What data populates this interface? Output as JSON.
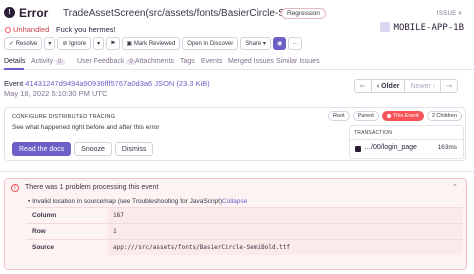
{
  "header": {
    "icon_glyph": "!",
    "title": "Error",
    "path": "TradeAssetScreen(src/assets/fonts/BasierCircle-SemiBold)",
    "badge": "Regression",
    "unhandled": "Unhandled",
    "subtitle": "Fuck you hermes!",
    "issue_label": "ISSUE #",
    "issue_id": "MOBILE-APP-1B"
  },
  "toolbar": {
    "resolve": "✓ Resolve",
    "resolve_menu": "▾",
    "ignore": "⊘ Ignore",
    "ignore_menu": "▾",
    "bookmark": "⚑",
    "mark_reviewed": "▣ Mark Reviewed",
    "open_discover": "Open in Discover",
    "share": "Share ▾",
    "extra_icon": "◉",
    "more": "···"
  },
  "tabs": [
    {
      "label": "Details"
    },
    {
      "label": "Activity",
      "badge": "0"
    },
    {
      "label": "User Feedback",
      "badge": "0"
    },
    {
      "label": "Attachments"
    },
    {
      "label": "Tags"
    },
    {
      "label": "Events"
    },
    {
      "label": "Merged Issues"
    },
    {
      "label": "Similar Issues"
    }
  ],
  "event": {
    "prefix": "Event",
    "id": "41431247d9494a90936fff5767a0d3a6",
    "json_link": "JSON (23.3 KiB)",
    "date": "May 18, 2022 5:10:30 PM UTC"
  },
  "event_nav": {
    "first": "⇤",
    "older": "‹ Older",
    "newer": "Newer ›",
    "last": "⇥"
  },
  "trace": {
    "heading": "CONFIGURE DISTRIBUTED TRACING",
    "description": "See what happened right before and after this error",
    "read_docs": "Read the docs",
    "snooze": "Snooze",
    "dismiss": "Dismiss",
    "pills": {
      "root": "Root",
      "parent": "Parent",
      "this_event": "This Event",
      "children": "2 Children"
    },
    "transaction_heading": "TRANSACTION",
    "transaction_path": "…/00/login_page",
    "transaction_duration": "163ms"
  },
  "alert": {
    "title": "There was 1 problem processing this event",
    "chevron": "⌃",
    "bullet": "• Invalid location in sourcemap (see Troubleshooting for JavaScript)",
    "collapse": "Collapse",
    "rows": [
      {
        "key": "Column",
        "value": "167"
      },
      {
        "key": "Row",
        "value": "1"
      },
      {
        "key": "Source",
        "value": "app:///src/assets/fonts/BasierCircle-SemiBold.ttf"
      }
    ]
  },
  "colors": {
    "accent": "#6c5fc7",
    "error": "#f55459",
    "text": "#2b1d38",
    "muted": "#80708f"
  }
}
